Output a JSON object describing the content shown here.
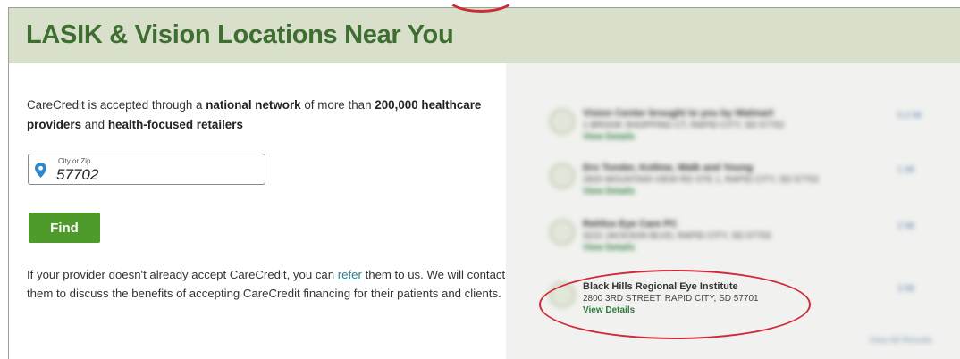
{
  "header": {
    "title": "LASIK & Vision Locations Near You"
  },
  "intro": {
    "text_1": "CareCredit is accepted through a ",
    "bold_1": "national network",
    "text_2": " of more than ",
    "bold_2": "200,000 healthcare providers",
    "text_3": " and ",
    "bold_3": "health-focused retailers"
  },
  "search": {
    "label": "City or Zip",
    "value": "57702"
  },
  "find_button": {
    "label": "Find"
  },
  "note": {
    "text_1": "If your provider doesn't already accept CareCredit, you can ",
    "link": "refer",
    "text_2": " them to us. We will contact them to discuss the benefits of accepting CareCredit financing for their patients and clients."
  },
  "results": [
    {
      "name": "Vision Center brought to you by Walmart",
      "address": "1 BROOK SHOPPING CT, RAPID CITY, SD 57702",
      "link": "View Details",
      "distance": "0.2 Mi"
    },
    {
      "name": "Drs Tonder, Kollme, Walk and Young",
      "address": "2820 MOUNTAIN VIEW RD STE 1, RAPID CITY, SD 57702",
      "link": "View Details",
      "distance": "1 Mi"
    },
    {
      "name": "Rehfus Eye Care PC",
      "address": "3222 JACKSON BLVD, RAPID CITY, SD 57702",
      "link": "View Details",
      "distance": "2 Mi"
    },
    {
      "name": "Black Hills Regional Eye Institute",
      "address": "2800 3RD STREET, RAPID CITY, SD 57701",
      "link": "View Details",
      "distance": "3 Mi"
    }
  ],
  "more_results": "View All Results",
  "colors": {
    "brand_green": "#4e9a2a",
    "header_bg": "#d8e0cc",
    "title_green": "#3f6f30",
    "highlight_red": "#cf2a3a"
  }
}
